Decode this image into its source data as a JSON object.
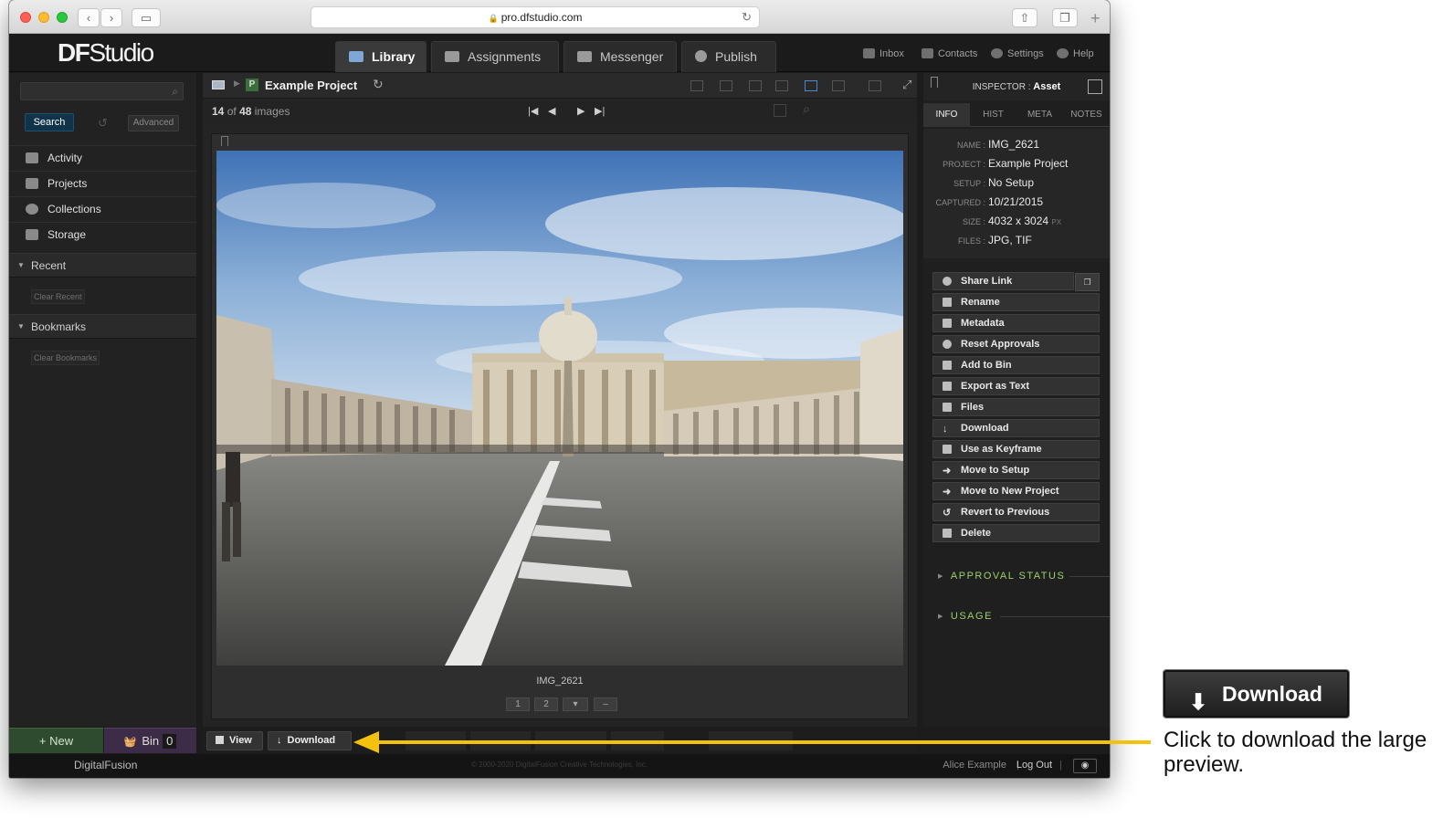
{
  "browser": {
    "url": "pro.dfstudio.com"
  },
  "app": {
    "logo_bold": "DF",
    "logo_rest": "Studio",
    "tabs": [
      {
        "label": "Library",
        "active": true
      },
      {
        "label": "Assignments",
        "active": false
      },
      {
        "label": "Messenger",
        "active": false
      },
      {
        "label": "Publish",
        "active": false
      }
    ],
    "top_links": [
      "Inbox",
      "Contacts",
      "Settings",
      "Help"
    ]
  },
  "sidebar": {
    "search_button": "Search",
    "advanced_button": "Advanced",
    "nav": [
      "Activity",
      "Projects",
      "Collections",
      "Storage"
    ],
    "recent_label": "Recent",
    "clear_recent": "Clear Recent",
    "bookmarks_label": "Bookmarks",
    "clear_bookmarks": "Clear Bookmarks",
    "new_button": "+ New",
    "bin_label": "Bin",
    "bin_count": "0"
  },
  "main": {
    "project_badge": "P",
    "project_title": "Example Project",
    "position": "14",
    "position_of": "of",
    "total": "48",
    "images_label": "images",
    "caption": "IMG_2621",
    "chips": [
      "1",
      "2",
      "–"
    ],
    "view_button": "View",
    "download_button": "Download"
  },
  "inspector": {
    "title_prefix": "INSPECTOR :",
    "title_value": "Asset",
    "tabs": [
      "INFO",
      "HIST",
      "META",
      "NOTES"
    ],
    "fields": [
      {
        "key": "NAME :",
        "value": "IMG_2621"
      },
      {
        "key": "PROJECT :",
        "value": "Example Project"
      },
      {
        "key": "SETUP :",
        "value": "No Setup"
      },
      {
        "key": "CAPTURED :",
        "value": "10/21/2015"
      },
      {
        "key": "SIZE :",
        "value": "4032 x 3024",
        "unit": "PX"
      },
      {
        "key": "FILES :",
        "value": "JPG, TIF"
      }
    ],
    "actions": [
      "Share Link",
      "Rename",
      "Metadata",
      "Reset Approvals",
      "Add to Bin",
      "Export as Text",
      "Files",
      "Download",
      "Use as Keyframe",
      "Move to Setup",
      "Move to New Project",
      "Revert to Previous",
      "Delete"
    ],
    "approval_status": "APPROVAL STATUS",
    "usage": "USAGE"
  },
  "footer": {
    "logo": "DigitalFusion",
    "copyright": "© 2000-2020 DigitalFusion Creative Technologies, Inc.",
    "user": "Alice Example",
    "logout": "Log Out"
  },
  "callout": {
    "button_label": "Download",
    "text": "Click to download the large preview."
  },
  "colors": {
    "accent_arrow": "#f4c20d",
    "section_header": "#9ad16b",
    "search_button": "#11334a"
  }
}
